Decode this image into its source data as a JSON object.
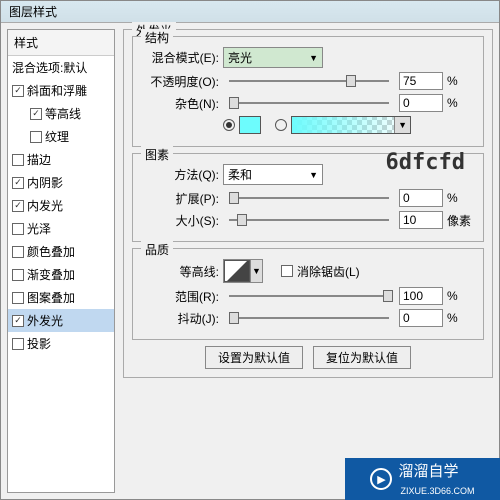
{
  "title": "图层样式",
  "annot": "6dfcfd",
  "left": {
    "header": "样式",
    "blend": "混合选项:默认",
    "items": [
      {
        "label": "斜面和浮雕",
        "checked": true,
        "indent": false
      },
      {
        "label": "等高线",
        "checked": true,
        "indent": true
      },
      {
        "label": "纹理",
        "checked": false,
        "indent": true
      },
      {
        "label": "描边",
        "checked": false,
        "indent": false
      },
      {
        "label": "内阴影",
        "checked": true,
        "indent": false
      },
      {
        "label": "内发光",
        "checked": true,
        "indent": false
      },
      {
        "label": "光泽",
        "checked": false,
        "indent": false
      },
      {
        "label": "颜色叠加",
        "checked": false,
        "indent": false
      },
      {
        "label": "渐变叠加",
        "checked": false,
        "indent": false
      },
      {
        "label": "图案叠加",
        "checked": false,
        "indent": false
      },
      {
        "label": "外发光",
        "checked": true,
        "indent": false,
        "sel": true
      },
      {
        "label": "投影",
        "checked": false,
        "indent": false
      }
    ]
  },
  "outer_glow": {
    "title": "外发光",
    "structure": {
      "legend": "结构",
      "blend_mode_label": "混合模式(E):",
      "blend_mode_value": "亮光",
      "opacity_label": "不透明度(O):",
      "opacity_value": "75",
      "opacity_unit": "%",
      "noise_label": "杂色(N):",
      "noise_value": "0",
      "noise_unit": "%"
    },
    "pattern": {
      "legend": "图素",
      "technique_label": "方法(Q):",
      "technique_value": "柔和",
      "spread_label": "扩展(P):",
      "spread_value": "0",
      "spread_unit": "%",
      "size_label": "大小(S):",
      "size_value": "10",
      "size_unit": "像素"
    },
    "quality": {
      "legend": "品质",
      "contour_label": "等高线:",
      "antialias_label": "消除锯齿(L)",
      "range_label": "范围(R):",
      "range_value": "100",
      "range_unit": "%",
      "jitter_label": "抖动(J):",
      "jitter_value": "0",
      "jitter_unit": "%"
    }
  },
  "buttons": {
    "set_default": "设置为默认值",
    "reset_default": "复位为默认值"
  },
  "watermark": {
    "brand": "溜溜自学",
    "sub": "ZIXUE.3D66.COM"
  }
}
